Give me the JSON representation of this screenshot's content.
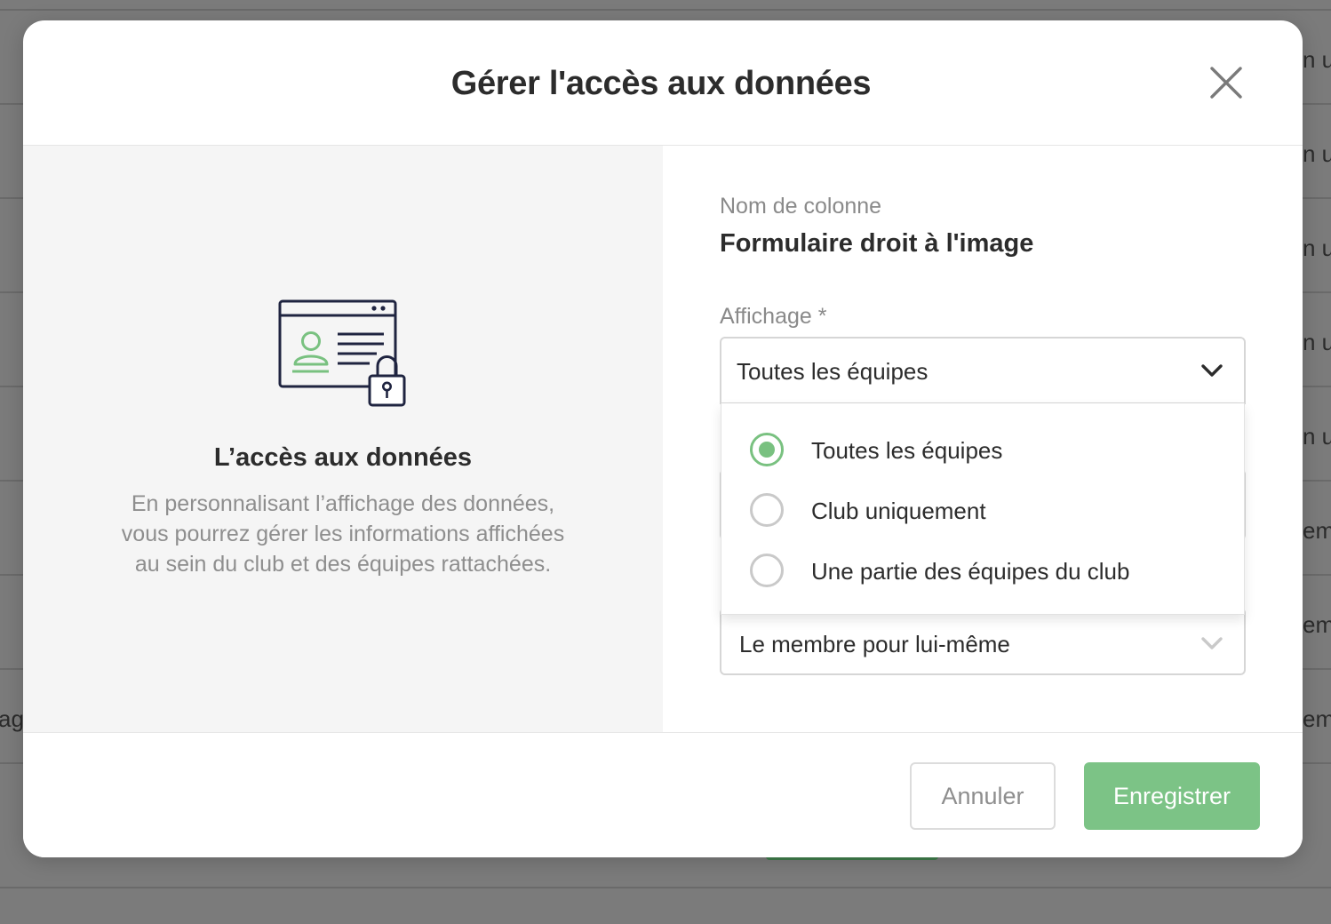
{
  "background": {
    "right_fragments": [
      "n u",
      "n u",
      "n u",
      "n u",
      "n u",
      "eml",
      "eml",
      "eml"
    ],
    "left_fragment": "ag"
  },
  "modal": {
    "title": "Gérer l'accès aux données",
    "close_icon": "close-icon"
  },
  "info": {
    "illustration_icon": "id-card-lock-icon",
    "title": "L’accès aux données",
    "description_lines": [
      "En personnalisant l’affichage des données,",
      "vous pourrez gérer les informations affichées",
      "au sein du club et des équipes rattachées."
    ]
  },
  "form": {
    "column_name_label": "Nom de colonne",
    "column_name_value": "Formulaire droit à l'image",
    "display_label": "Affichage *",
    "display_selected": "Toutes les équipes",
    "display_options": [
      {
        "label": "Toutes les équipes",
        "checked": true
      },
      {
        "label": "Club uniquement",
        "checked": false
      },
      {
        "label": "Une partie des équipes du club",
        "checked": false
      }
    ],
    "second_select_value": "Le membre pour lui-même"
  },
  "footer": {
    "cancel_label": "Annuler",
    "save_label": "Enregistrer"
  },
  "colors": {
    "accent_green": "#7cc386",
    "radio_green": "#79c180",
    "text_dark": "#2c2c2c",
    "text_muted": "#8e8e8e",
    "overlay": "#7b7b7b"
  }
}
